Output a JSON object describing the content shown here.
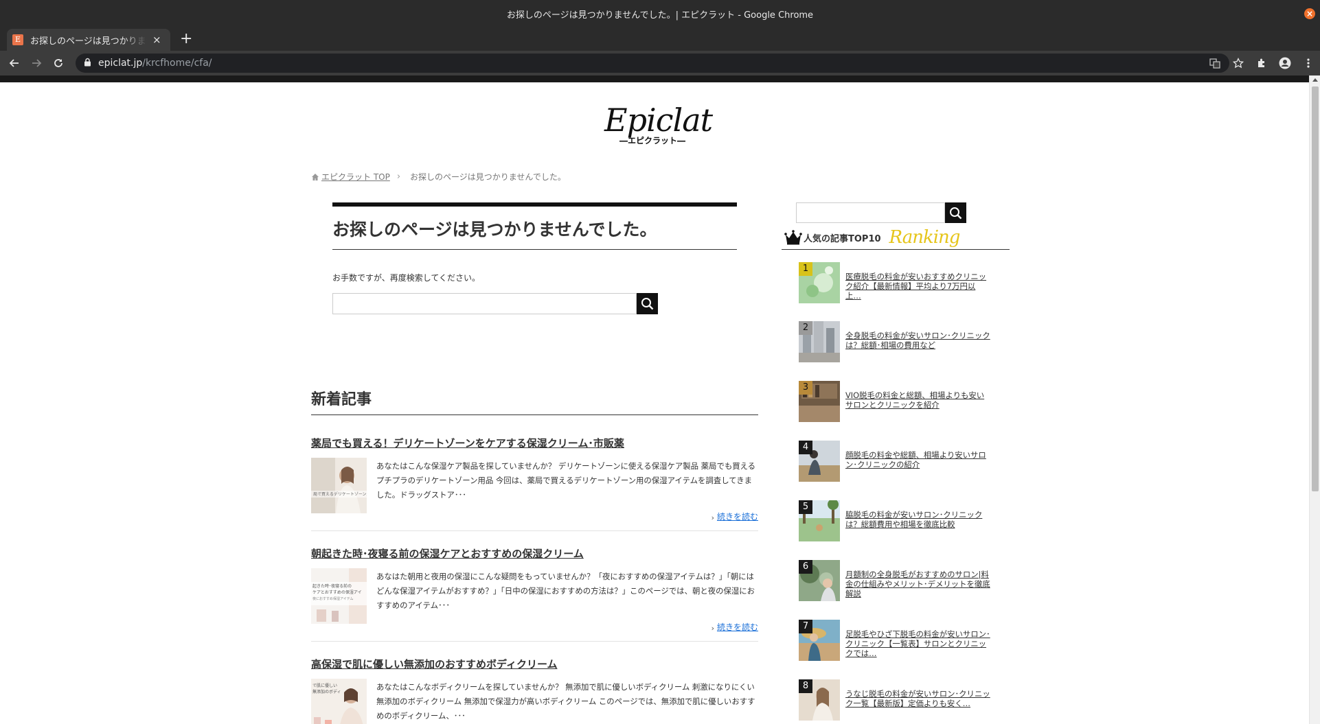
{
  "window": {
    "title": "お探しのページは見つかりませんでした。| エピクラット - Google Chrome",
    "close_glyph": "×"
  },
  "tab": {
    "favicon_letter": "E",
    "title": "お探しのページは見つかりませんでした。",
    "close_glyph": "×",
    "new_tab_glyph": "+"
  },
  "address": {
    "host": "epiclat.jp",
    "path": "/krcfhome/cfa/"
  },
  "logo": {
    "main": "Epiclat",
    "sub": "―エピクラット―"
  },
  "breadcrumb": {
    "home_label": "エピクラット TOP",
    "separator": "›",
    "current": "お探しのページは見つかりませんでした。"
  },
  "not_found": {
    "heading": "お探しのページは見つかりませんでした。",
    "message": "お手数ですが、再度検索してください。",
    "search_placeholder": ""
  },
  "latest": {
    "heading": "新着記事",
    "more_label": "続きを読む",
    "articles": [
      {
        "title": "薬局でも買える！デリケートゾーンをケアする保湿クリーム･市販薬",
        "excerpt": "あなたはこんな保湿ケア製品を探していませんか？ デリケートゾーンに使える保湿ケア製品 薬局でも買えるプチプラのデリケートゾーン用品 今回は、薬局で買えるデリケートゾーン用の保湿アイテムを調査してきました。ドラッグストア･･･",
        "thumb_caption": "局で買えるデリケートゾーン用アイテム"
      },
      {
        "title": "朝起きた時･夜寝る前の保湿ケアとおすすめの保湿クリーム",
        "excerpt": "あなはた朝用と夜用の保湿にこんな疑問をもっていませんか？「夜におすすめの保湿アイテムは？」「朝にはどんな保湿アイテムがおすすめ？」「日中の保湿におすすめの方法は？」このページでは、朝と夜の保湿におすすめのアイテム･･･",
        "thumb_caption": "起きた時･夜寝る前の保湿ケアとおすすめの保湿アイテム"
      },
      {
        "title": "高保湿で肌に優しい無添加のおすすめボディクリーム",
        "excerpt": "あなたはこんなボディクリームを探していませんか？ 無添加で肌に優しいボディクリーム 刺激になりにくい無添加のボディクリーム 無添加で保湿力が高いボディクリーム このページでは、無添加で肌に優しいおすすめのボディクリーム、･･･",
        "thumb_caption": "で肌に優しい無添加ボディクリーム"
      }
    ]
  },
  "sidebar": {
    "search_placeholder": "",
    "ranking_label": "人気の記事TOP10",
    "ranking_script": "Ranking",
    "items": [
      {
        "rank": "1",
        "title": "医療脱毛の料金が安いおすすめクリニック紹介【最新情報】平均より7万円以上…",
        "badge_color": "#d8c21a"
      },
      {
        "rank": "2",
        "title": "全身脱毛の料金が安いサロン･クリニックは？総額･相場の費用など",
        "badge_color": "#9a9a9a"
      },
      {
        "rank": "3",
        "title": "VIO脱毛の料金と総額、相場よりも安いサロンとクリニックを紹介",
        "badge_color": "#b88a3a"
      },
      {
        "rank": "4",
        "title": "顔脱毛の料金や総額、相場より安いサロン･クリニックの紹介",
        "badge_color": "#1a1a1a"
      },
      {
        "rank": "5",
        "title": "脇脱毛の料金が安いサロン･クリニックは？総額費用や相場を徹底比較",
        "badge_color": "#1a1a1a"
      },
      {
        "rank": "6",
        "title": "月額制の全身脱毛がおすすめのサロン|料金の仕組みやメリット･デメリットを徹底解説",
        "badge_color": "#1a1a1a"
      },
      {
        "rank": "7",
        "title": "足脱毛やひざ下脱毛の料金が安いサロン･クリニック【一覧表】サロンとクリニックでは…",
        "badge_color": "#1a1a1a"
      },
      {
        "rank": "8",
        "title": "うなじ脱毛の料金が安いサロン･クリニック一覧【最新版】定価よりも安く…",
        "badge_color": "#1a1a1a"
      }
    ]
  }
}
